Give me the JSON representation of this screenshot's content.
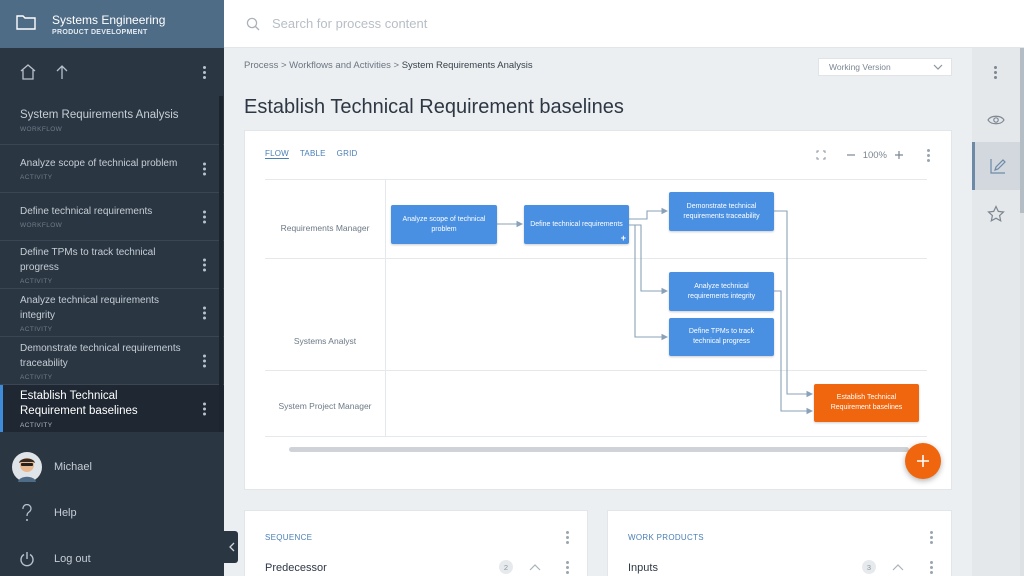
{
  "sidebar": {
    "header": {
      "title": "Systems Engineering",
      "subtitle": "PRODUCT DEVELOPMENT"
    },
    "items": [
      {
        "label": "System Requirements Analysis",
        "type": "WORKFLOW"
      },
      {
        "label": "Analyze scope of technical problem",
        "type": "ACTIVITY"
      },
      {
        "label": "Define technical requirements",
        "type": "WORKFLOW"
      },
      {
        "label": "Define TPMs to track technical progress",
        "type": "ACTIVITY"
      },
      {
        "label": "Analyze technical requirements integrity",
        "type": "ACTIVITY"
      },
      {
        "label": "Demonstrate technical requirements traceability",
        "type": "ACTIVITY"
      },
      {
        "label": "Establish Technical Requirement baselines",
        "type": "ACTIVITY"
      }
    ],
    "user": {
      "name": "Michael"
    },
    "help_label": "Help",
    "logout_label": "Log out"
  },
  "search": {
    "placeholder": "Search for process content"
  },
  "breadcrumb": {
    "path": "Process > Workflows and Activities > ",
    "current": "System Requirements Analysis"
  },
  "version": {
    "selected": "Working Version"
  },
  "page_title": "Establish Technical Requirement baselines",
  "flow": {
    "tabs": [
      "FLOW",
      "TABLE",
      "GRID"
    ],
    "active_tab": "FLOW",
    "zoom": "100%",
    "lanes": [
      "Requirements Manager",
      "Systems Analyst",
      "System Project Manager"
    ],
    "nodes": {
      "analyze_scope": "Analyze scope of technical problem",
      "define_req": "Define technical requirements",
      "demonstrate": "Demonstrate technical requirements traceability",
      "analyze_integrity": "Analyze technical requirements integrity",
      "define_tpms": "Define TPMs to track technical progress",
      "establish": "Establish Technical Requirement baselines"
    }
  },
  "sequence": {
    "heading": "SEQUENCE",
    "row_label": "Predecessor",
    "count": "2"
  },
  "work_products": {
    "heading": "WORK PRODUCTS",
    "row_label": "Inputs",
    "count": "3"
  },
  "colors": {
    "accent": "#4a90e2",
    "highlight": "#f0660f",
    "sidebar": "#2b3643",
    "sidebar_header": "#4f6c87"
  }
}
